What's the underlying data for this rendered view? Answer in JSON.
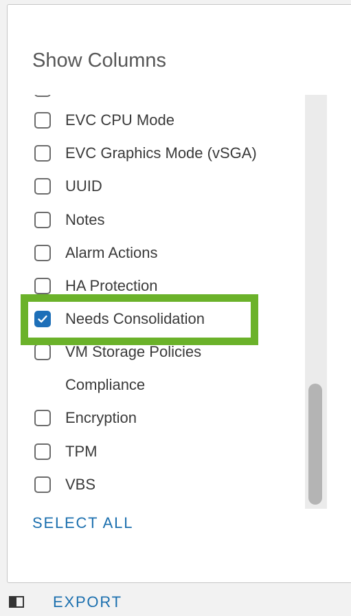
{
  "panel": {
    "title": "Show Columns",
    "select_all_label": "SELECT ALL"
  },
  "columns": [
    {
      "label": "",
      "checked": false
    },
    {
      "label": "EVC CPU Mode",
      "checked": false
    },
    {
      "label": "EVC Graphics Mode (vSGA)",
      "checked": false
    },
    {
      "label": "UUID",
      "checked": false
    },
    {
      "label": "Notes",
      "checked": false
    },
    {
      "label": "Alarm Actions",
      "checked": false
    },
    {
      "label": "HA Protection",
      "checked": false
    },
    {
      "label": "Needs Consolidation",
      "checked": true
    },
    {
      "label": "VM Storage Policies",
      "checked": false
    },
    {
      "label": "Encryption",
      "checked": false
    },
    {
      "label": "TPM",
      "checked": false
    },
    {
      "label": "VBS",
      "checked": false
    }
  ],
  "wrapped_label_continuation": "Compliance",
  "footer": {
    "columns_icon": "column-toggle-icon",
    "export_label": "EXPORT"
  },
  "colors": {
    "accent": "#1b6fae",
    "checked": "#1d6fb8",
    "highlight": "#6bb22a"
  }
}
